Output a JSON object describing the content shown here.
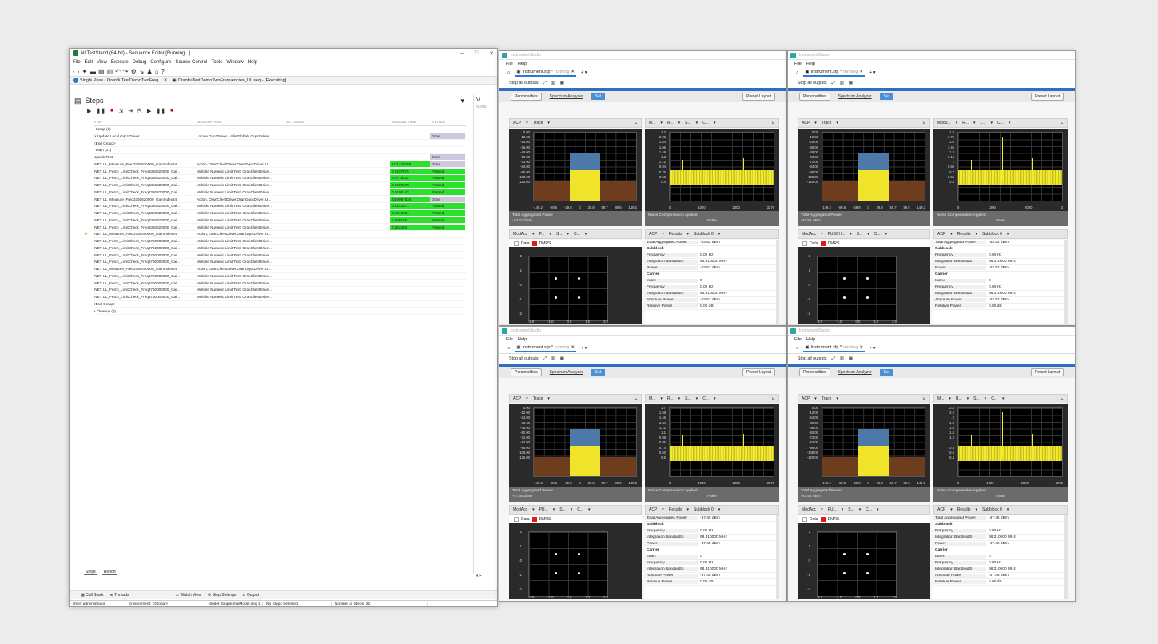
{
  "teststand": {
    "title": "NI TestStand (64-bit) - Sequence Editor [Running...]",
    "menu": [
      "File",
      "Edit",
      "View",
      "Execute",
      "Debug",
      "Configure",
      "Source Control",
      "Tools",
      "Window",
      "Help"
    ],
    "doc_tabs": [
      "Single Pass - OranfluTestDemoTwoFreq...",
      "OranfluTestDemoTwoFrequencies_UL.seq - [Executing]"
    ],
    "pane_title": "Steps",
    "side_pane": {
      "title": "V...",
      "sub": "NAME"
    },
    "columns": [
      "STEP",
      "DESCRIPTION",
      "SETTINGS",
      "MODULE TIME",
      "STATUS"
    ],
    "rows": [
      {
        "step": "- Setup (1)",
        "desc": "",
        "mod": "",
        "stat": "",
        "cls": ""
      },
      {
        "step": "   fx Update Local Gqcc Driver",
        "desc": "Locate GqccDriver = FileGlobals.GqccDriver",
        "mod": "",
        "stat": "Done",
        "cls": "done"
      },
      {
        "step": "   <End Group>",
        "desc": "",
        "mod": "",
        "stat": "",
        "cls": ""
      },
      {
        "step": "- Main (21)",
        "desc": "",
        "mod": "",
        "stat": "",
        "cls": ""
      },
      {
        "step": "   UpLink Test",
        "desc": "",
        "mod": "",
        "stat": "Done",
        "cls": "done"
      },
      {
        "step": "   .NET UL_Measure_Freq3350820000_GainIndex24",
        "desc": "Action, OranClientDriver.OranGqccDriver. U...",
        "mod": "17.1425768",
        "stat": "Done",
        "cls": "done mod"
      },
      {
        "step": "   .NET UL_Fetch_LimitCheck_Freq3350820000_Gai...",
        "desc": "Multiple Numeric Limit Test, OranClientDrive...",
        "mod": "0.0107875",
        "stat": "Passed",
        "cls": "passed"
      },
      {
        "step": "   .NET UL_Fetch_LimitCheck_Freq3350820000_Gai...",
        "desc": "Multiple Numeric Limit Test, OranClientDrive...",
        "mod": "0.0778232",
        "stat": "Passed",
        "cls": "passed"
      },
      {
        "step": "   .NET UL_Fetch_LimitCheck_Freq3350820000_Gai...",
        "desc": "Multiple Numeric Limit Test, OranClientDrive...",
        "mod": "0.0000378",
        "stat": "Passed",
        "cls": "passed"
      },
      {
        "step": "   .NET UL_Fetch_LimitCheck_Freq3350820000_Gai...",
        "desc": "Multiple Numeric Limit Test, OranClientDrive...",
        "mod": "0.0105142",
        "stat": "Passed",
        "cls": "passed"
      },
      {
        "step": "   .NET UL_Measure_Freq3350820000_GainIndex24",
        "desc": "Action, OranClientDriver.OranGqccDriver. U...",
        "mod": "23.9987834",
        "stat": "Done",
        "cls": "done mod"
      },
      {
        "step": "   .NET UL_Fetch_LimitCheck_Freq3350820000_Gai...",
        "desc": "Multiple Numeric Limit Test, OranClientDrive...",
        "mod": "0.0142871",
        "stat": "Passed",
        "cls": "passed"
      },
      {
        "step": "   .NET UL_Fetch_LimitCheck_Freq3350820000_Gai...",
        "desc": "Multiple Numeric Limit Test, OranClientDrive...",
        "mod": "0.0049624",
        "stat": "Passed",
        "cls": "passed"
      },
      {
        "step": "   .NET UL_Fetch_LimitCheck_Freq3350820000_Gai...",
        "desc": "Multiple Numeric Limit Test, OranClientDrive...",
        "mod": "0.000195",
        "stat": "Passed",
        "cls": "passed"
      },
      {
        "step": "   .NET UL_Fetch_LimitCheck_Freq3350820000_Gai...",
        "desc": "Multiple Numeric Limit Test, OranClientDrive...",
        "mod": "0.004004",
        "stat": "Passed",
        "cls": "passed"
      },
      {
        "step": "   .NET UL_Measure_Freq3750000000_GainIndex24",
        "desc": "Action, OranClientDriver.OranGqccDriver. U...",
        "mod": "",
        "stat": "",
        "cls": "",
        "arrow": true
      },
      {
        "step": "   .NET UL_Fetch_LimitCheck_Freq3750000000_Gai...",
        "desc": "Multiple Numeric Limit Test, OranClientDrive...",
        "mod": "",
        "stat": "",
        "cls": ""
      },
      {
        "step": "   .NET UL_Fetch_LimitCheck_Freq3750000000_Gai...",
        "desc": "Multiple Numeric Limit Test, OranClientDrive...",
        "mod": "",
        "stat": "",
        "cls": ""
      },
      {
        "step": "   .NET UL_Fetch_LimitCheck_Freq3750000000_Gai...",
        "desc": "Multiple Numeric Limit Test, OranClientDrive...",
        "mod": "",
        "stat": "",
        "cls": ""
      },
      {
        "step": "   .NET UL_Fetch_LimitCheck_Freq3750000000_Gai...",
        "desc": "Multiple Numeric Limit Test, OranClientDrive...",
        "mod": "",
        "stat": "",
        "cls": ""
      },
      {
        "step": "   .NET UL_Measure_Freq3750000000_GainIndex24",
        "desc": "Action, OranClientDriver.OranGqccDriver. U...",
        "mod": "",
        "stat": "",
        "cls": ""
      },
      {
        "step": "   .NET UL_Fetch_LimitCheck_Freq3750000000_Gai...",
        "desc": "Multiple Numeric Limit Test, OranClientDrive...",
        "mod": "",
        "stat": "",
        "cls": ""
      },
      {
        "step": "   .NET UL_Fetch_LimitCheck_Freq3750000000_Gai...",
        "desc": "Multiple Numeric Limit Test, OranClientDrive...",
        "mod": "",
        "stat": "",
        "cls": ""
      },
      {
        "step": "   .NET UL_Fetch_LimitCheck_Freq3750000000_Gai...",
        "desc": "Multiple Numeric Limit Test, OranClientDrive...",
        "mod": "",
        "stat": "",
        "cls": ""
      },
      {
        "step": "   .NET UL_Fetch_LimitCheck_Freq3750000000_Gai...",
        "desc": "Multiple Numeric Limit Test, OranClientDrive...",
        "mod": "",
        "stat": "",
        "cls": ""
      },
      {
        "step": "   <End Group>",
        "desc": "",
        "mod": "",
        "stat": "",
        "cls": ""
      },
      {
        "step": "+ Cleanup (0)",
        "desc": "",
        "mod": "",
        "stat": "",
        "cls": ""
      }
    ],
    "bottom_tabs": [
      "Steps",
      "Report"
    ],
    "bottom_bar": [
      "Call Stack",
      "Threads",
      "Watch View",
      "Step Settings",
      "Output"
    ],
    "status": [
      "User: administrator",
      "Environment: <Global>",
      "Model: SequentialModel.seq  1",
      "No Steps Selected",
      "Number of Steps: 22"
    ]
  },
  "instruments": [
    {
      "title": "InstrumentStudio",
      "menu": [
        "File",
        "Help"
      ],
      "tab": "Instrument.sfp *",
      "tab_state": "running",
      "toolbar": "Stop all outputs",
      "personalities": "Personalities",
      "sa": "Spectrum Analyzer",
      "set": "Set",
      "preset": "Preset Layout",
      "left_hdr": [
        "ACP",
        "Trace"
      ],
      "right_hdr": [
        "M...",
        "R...",
        "S...",
        "C..."
      ],
      "yticks_left": [
        "0.00",
        "-12.00",
        "-24.00",
        "-36.00",
        "-48.00",
        "-60.00",
        "-72.00",
        "-84.00",
        "-96.00",
        "-108.00",
        "-120.00"
      ],
      "xticks_left": [
        "-149.2",
        "-89.5",
        "-29.8",
        "0",
        "29.8",
        "59.7",
        "89.5",
        "149.2"
      ],
      "yticks_right": [
        "2.2",
        "2.02",
        "1.84",
        "1.66",
        "1.48",
        "1.3",
        "1.12",
        "0.94",
        "0.76",
        "0.58",
        "0.4"
      ],
      "xticks_right": [
        "0",
        "1000",
        "2000",
        "3276"
      ],
      "foot_left": [
        "Total Aggregated Power",
        "-43.52 dBm"
      ],
      "foot_right": [
        "Noise Compensation Applied",
        "False"
      ],
      "bot_left_hdr": [
        "ModAcc",
        "P...",
        "S...",
        "C..."
      ],
      "bot_right_hdr": [
        "ACP",
        "Results",
        "Subblock 0"
      ],
      "legend": [
        "Data",
        "DMRS"
      ],
      "c_yticks": [
        "2",
        "1",
        "0",
        "-1",
        "-2"
      ],
      "c_xticks": [
        "-2.0",
        "-1.0",
        "0.0",
        "1.0",
        "2.0"
      ],
      "results": [
        {
          "k": "Total Aggregated Power",
          "v": "-43.52 dBm"
        },
        {
          "sec": "Subblock"
        },
        {
          "k": "Frequency",
          "v": "0.00 Hz"
        },
        {
          "k": "Integration Bandwidth",
          "v": "98.310000 MHz"
        },
        {
          "k": "Power",
          "v": "-43.52 dBm"
        },
        {
          "sec": "Carrier"
        },
        {
          "k": "Index",
          "v": "0"
        },
        {
          "k": "Frequency",
          "v": "0.00 Hz"
        },
        {
          "k": "Integration Bandwidth",
          "v": "98.310000 MHz"
        },
        {
          "k": "Absolute Power",
          "v": "-43.52 dBm"
        },
        {
          "k": "Relative Power",
          "v": "0.00 dB"
        }
      ]
    },
    {
      "title": "InstrumentStudio",
      "menu": [
        "File",
        "Help"
      ],
      "tab": "Instrument.sfp *",
      "tab_state": "running",
      "toolbar": "Stop all outputs",
      "personalities": "Personalities",
      "sa": "Spectrum Analyzer",
      "set": "Set",
      "preset": "Preset Layout",
      "left_hdr": [
        "ACP",
        "Trace"
      ],
      "right_hdr": [
        "Modu...",
        "R...",
        "L...",
        "C..."
      ],
      "yticks_left": [
        "0.00",
        "-12.00",
        "-24.00",
        "-36.00",
        "-48.00",
        "-60.00",
        "-72.00",
        "-84.00",
        "-96.00",
        "-108.00",
        "-120.00"
      ],
      "xticks_left": [
        "-149.2",
        "-89.5",
        "-29.8",
        "0",
        "29.8",
        "59.7",
        "89.5",
        "149.2"
      ],
      "yticks_right": [
        "1.9",
        "1.75",
        "1.6",
        "1.45",
        "1.3",
        "1.15",
        "1",
        "0.85",
        "0.7",
        "0.55",
        "0.4"
      ],
      "xticks_right": [
        "0",
        "1000",
        "2000",
        "3"
      ],
      "foot_left": [
        "Total Aggregated Power",
        "-43.52 dBm"
      ],
      "foot_right": [
        "Noise Compensation Applied",
        "False"
      ],
      "bot_left_hdr": [
        "ModAcc",
        "PUSCH...",
        "S...",
        "C..."
      ],
      "bot_right_hdr": [
        "ACP",
        "Results",
        "Subblock 0"
      ],
      "legend": [
        "Data",
        "DMRS"
      ],
      "c_yticks": [
        "2",
        "1",
        "0",
        "-1",
        "-2"
      ],
      "c_xticks": [
        "-2.0",
        "-1.0",
        "0.0",
        "1.0",
        "2.0"
      ],
      "results": [
        {
          "k": "Total Aggregated Power",
          "v": "-43.52 dBm"
        },
        {
          "sec": "Subblock"
        },
        {
          "k": "Frequency",
          "v": "0.00 Hz"
        },
        {
          "k": "Integration Bandwidth",
          "v": "98.310000 MHz"
        },
        {
          "k": "Power",
          "v": "-43.52 dBm"
        },
        {
          "sec": "Carrier"
        },
        {
          "k": "Index",
          "v": "0"
        },
        {
          "k": "Frequency",
          "v": "0.00 Hz"
        },
        {
          "k": "Integration Bandwidth",
          "v": "98.310000 MHz"
        },
        {
          "k": "Absolute Power",
          "v": "-43.52 dBm"
        },
        {
          "k": "Relative Power",
          "v": "0.00 dB"
        }
      ]
    },
    {
      "title": "InstrumentStudio",
      "menu": [
        "File",
        "Help"
      ],
      "tab": "Instrument.sfp *",
      "tab_state": "running",
      "toolbar": "Stop all outputs",
      "personalities": "Personalities",
      "sa": "Spectrum Analyzer",
      "set": "Set",
      "preset": "Preset Layout",
      "left_hdr": [
        "ACP",
        "Trace"
      ],
      "right_hdr": [
        "M...",
        "R...",
        "S...",
        "C..."
      ],
      "yticks_left": [
        "0.00",
        "-12.00",
        "-24.00",
        "-36.00",
        "-48.00",
        "-60.00",
        "-72.00",
        "-84.00",
        "-96.00",
        "-108.00",
        "-120.00"
      ],
      "xticks_left": [
        "-149.2",
        "-89.5",
        "-29.8",
        "0",
        "29.8",
        "59.7",
        "89.5",
        "149.2"
      ],
      "yticks_right": [
        "1.7",
        "1.58",
        "1.46",
        "1.34",
        "1.22",
        "1.1",
        "0.98",
        "0.86",
        "0.74",
        "0.62",
        "0.5"
      ],
      "xticks_right": [
        "0",
        "1000",
        "2000",
        "3276"
      ],
      "foot_left": [
        "Total Aggregated Power",
        "-47.45 dBm"
      ],
      "foot_right": [
        "Noise Compensation Applied",
        "False"
      ],
      "bot_left_hdr": [
        "ModAcc",
        "PU...",
        "S...",
        "C..."
      ],
      "bot_right_hdr": [
        "ACP",
        "Results",
        "Subblock 0"
      ],
      "legend": [
        "Data",
        "DMRS"
      ],
      "c_yticks": [
        "2",
        "1",
        "0",
        "-1",
        "-2"
      ],
      "c_xticks": [
        "-2.0",
        "-1.0",
        "0.0",
        "1.0",
        "2.0"
      ],
      "results": [
        {
          "k": "Total Aggregated Power",
          "v": "-47.45 dBm"
        },
        {
          "sec": "Subblock"
        },
        {
          "k": "Frequency",
          "v": "0.00 Hz"
        },
        {
          "k": "Integration Bandwidth",
          "v": "98.310000 MHz"
        },
        {
          "k": "Power",
          "v": "-47.45 dBm"
        },
        {
          "sec": "Carrier"
        },
        {
          "k": "Index",
          "v": "0"
        },
        {
          "k": "Frequency",
          "v": "0.00 Hz"
        },
        {
          "k": "Integration Bandwidth",
          "v": "98.310000 MHz"
        },
        {
          "k": "Absolute Power",
          "v": "-47.45 dBm"
        },
        {
          "k": "Relative Power",
          "v": "0.00 dB"
        }
      ]
    },
    {
      "title": "InstrumentStudio",
      "menu": [
        "File",
        "Help"
      ],
      "tab": "Instrument.sfp *",
      "tab_state": "running",
      "toolbar": "Stop all outputs",
      "personalities": "Personalities",
      "sa": "Spectrum Analyzer",
      "set": "Set",
      "preset": "Preset Layout",
      "left_hdr": [
        "ACP",
        "Trace"
      ],
      "right_hdr": [
        "M...",
        "R...",
        "S...",
        "C..."
      ],
      "yticks_left": [
        "0.00",
        "-12.00",
        "-24.00",
        "-36.00",
        "-48.00",
        "-60.00",
        "-72.00",
        "-84.00",
        "-96.00",
        "-108.00",
        "-120.00"
      ],
      "xticks_left": [
        "-149.2",
        "-89.5",
        "-29.8",
        "0",
        "29.8",
        "59.7",
        "89.5",
        "149.2"
      ],
      "yticks_right": [
        "2.4",
        "2.2",
        "2",
        "1.8",
        "1.6",
        "1.4",
        "1.2",
        "1",
        "0.8",
        "0.6",
        "0.4"
      ],
      "xticks_right": [
        "0",
        "1000",
        "2000",
        "3276"
      ],
      "foot_left": [
        "Total Aggregated Power",
        "-47.46 dBm"
      ],
      "foot_right": [
        "Noise Compensation Applied",
        "False"
      ],
      "bot_left_hdr": [
        "ModAcc",
        "PU...",
        "S...",
        "C..."
      ],
      "bot_right_hdr": [
        "ACP",
        "Results",
        "Subblock 0"
      ],
      "legend": [
        "Data",
        "DMRS"
      ],
      "c_yticks": [
        "2",
        "1",
        "0",
        "-1",
        "-2"
      ],
      "c_xticks": [
        "-2.0",
        "-1.0",
        "0.0",
        "1.0",
        "2.0"
      ],
      "results": [
        {
          "k": "Total Aggregated Power",
          "v": "-47.46 dBm"
        },
        {
          "sec": "Subblock"
        },
        {
          "k": "Frequency",
          "v": "0.00 Hz"
        },
        {
          "k": "Integration Bandwidth",
          "v": "98.310000 MHz"
        },
        {
          "k": "Power",
          "v": "-47.46 dBm"
        },
        {
          "sec": "Carrier"
        },
        {
          "k": "Index",
          "v": "0"
        },
        {
          "k": "Frequency",
          "v": "0.00 Hz"
        },
        {
          "k": "Integration Bandwidth",
          "v": "98.310000 MHz"
        },
        {
          "k": "Absolute Power",
          "v": "-47.46 dBm"
        },
        {
          "k": "Relative Power",
          "v": "0.00 dB"
        }
      ]
    }
  ]
}
